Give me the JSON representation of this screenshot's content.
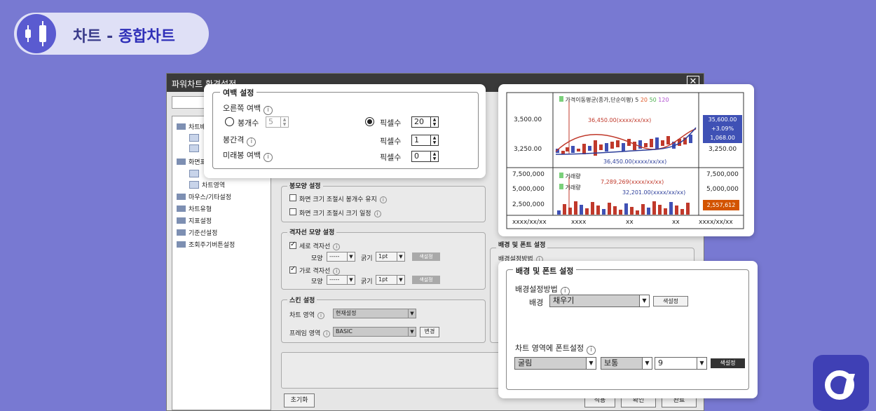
{
  "header": {
    "title_prefix": "차트 - ",
    "title_accent": "종합차트"
  },
  "dialog": {
    "title": "파워차트 환경설정",
    "close_glyph": "✕",
    "tree": [
      {
        "label": "차트배"
      },
      {
        "label": "화면표"
      },
      {
        "label": "차트영역"
      },
      {
        "label": "마우스/기타설정"
      },
      {
        "label": "차트유형"
      },
      {
        "label": "지표설정"
      },
      {
        "label": "기준선설정"
      },
      {
        "label": "조회주기버튼설정"
      }
    ],
    "candle_group": {
      "title": "봉모양 설정",
      "opt1": "화면 크기 조절시 봉개수 유지",
      "opt2": "화면 크기 조절시 크기 일정"
    },
    "grid_group": {
      "title": "격자선 모양 설정",
      "vertical": "세로 격자선",
      "horizontal": "가로 격자선",
      "shape_label": "모양",
      "shape_value": "-----",
      "width_label": "굵기",
      "width_value": "1pt",
      "color_btn": "색설정"
    },
    "skin_group": {
      "title": "스킨 설정",
      "chart_area_label": "차트 영역",
      "chart_area_value": "현재설정",
      "frame_label": "프레임 영역",
      "frame_value": "BASIC",
      "change_btn": "변경"
    },
    "right_side": {
      "bg_title": "배경 및 폰트 설정",
      "bg_method": "배경설정방법"
    },
    "footer": {
      "reset": "초기화",
      "apply": "적용",
      "ok": "확인",
      "done": "완료"
    }
  },
  "margin_popup": {
    "title": "여백 설정",
    "right_margin": "오른쪽 여백",
    "candle_count": "봉개수",
    "candle_count_value": "5",
    "pixel": "픽셀수",
    "pixel_value": "20",
    "candle_gap": "봉간격",
    "gap_pixel": "픽셀수",
    "gap_value": "1",
    "future_margin": "미래봉 여백",
    "future_pixel": "픽셀수",
    "future_value": "0"
  },
  "bg_popup": {
    "title": "배경 및 폰트 설정",
    "method_label": "배경설정방법",
    "bg_label": "배경",
    "bg_value": "채우기",
    "color_btn": "색설정",
    "font_label": "차트 영역에 폰트설정",
    "font_name": "굴림",
    "font_style": "보통",
    "font_size": "9",
    "font_color_btn": "색설정"
  },
  "chart_popup": {
    "legend_ma": "가격이동평균(종가,단순이평)",
    "ma_periods": [
      "5",
      "20",
      "50",
      "120"
    ],
    "ma_colors": [
      "#333333",
      "#e05a2a",
      "#4caf50",
      "#b04fd0"
    ],
    "price_ticks": [
      "3,500.00",
      "3,250.00"
    ],
    "price_ticks_right": [
      "3,250.00"
    ],
    "annot_high": "36,450.00(xxxx/xx/xx)",
    "annot_low": "36,450.00(xxxx/xx/xx)",
    "last_price": "35,600.00",
    "last_change": "+3.09%",
    "last_volume": "1,068.00",
    "volume_legend": "거래량",
    "volume_ticks": [
      "7,500,000",
      "5,000,000",
      "2,500,000"
    ],
    "vol_annot_high": "7,289,269(xxxx/xx/xx)",
    "vol_annot_low": "32,201.00(xxxx/xx/xx)",
    "last_vol": "2,557,612",
    "x_labels": [
      "xxxx/xx/xx",
      "xxxx",
      "xx",
      "xx",
      "xxxx/xx/xx"
    ]
  }
}
